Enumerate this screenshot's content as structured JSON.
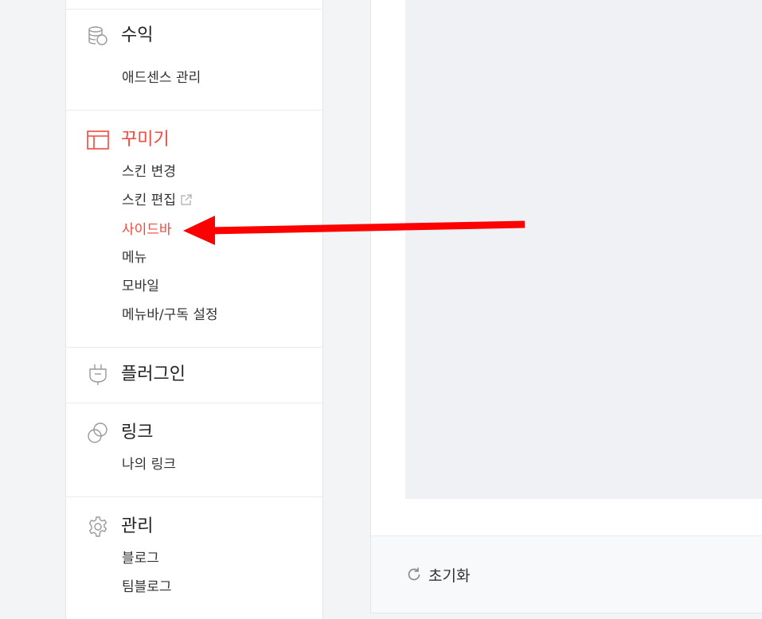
{
  "sidebar": {
    "revenue": {
      "title": "수익",
      "icon": "coins-icon",
      "items": [
        "애드센스 관리"
      ]
    },
    "decorate": {
      "title": "꾸미기",
      "icon": "layout-icon",
      "items": [
        "스킨 변경",
        "스킨 편집",
        "사이드바",
        "메뉴",
        "모바일",
        "메뉴바/구독 설정"
      ],
      "active_item": "사이드바",
      "external_item_icon": "external-link-icon"
    },
    "plugin": {
      "title": "플러그인",
      "icon": "plug-icon"
    },
    "link": {
      "title": "링크",
      "icon": "link-icon",
      "items": [
        "나의 링크"
      ]
    },
    "manage": {
      "title": "관리",
      "icon": "gear-icon",
      "items": [
        "블로그",
        "팀블로그"
      ]
    }
  },
  "footer": {
    "reset_label": "초기화",
    "reset_icon": "refresh-icon"
  },
  "annotation": {
    "arrow_color": "#ff0000"
  },
  "colors": {
    "accent": "#f0493e"
  }
}
